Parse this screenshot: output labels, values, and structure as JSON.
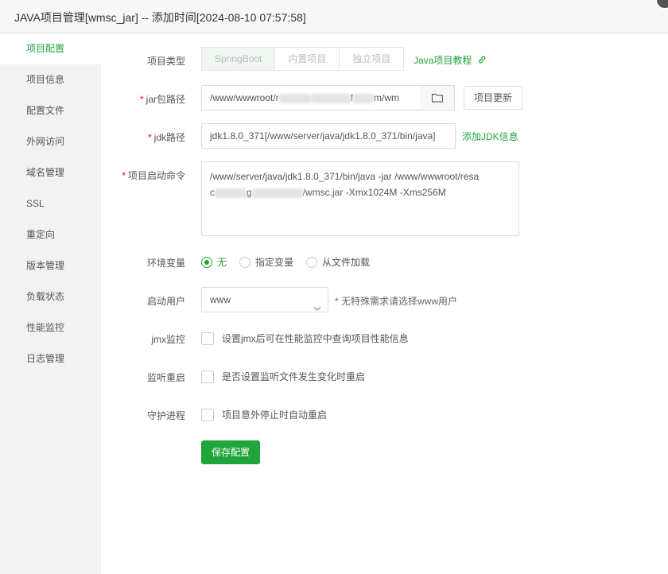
{
  "window": {
    "title": "JAVA项目管理[wmsc_jar] -- 添加时间[2024-08-10 07:57:58]"
  },
  "sidebar": {
    "items": [
      {
        "label": "项目配置",
        "active": true
      },
      {
        "label": "项目信息"
      },
      {
        "label": "配置文件"
      },
      {
        "label": "外网访问"
      },
      {
        "label": "域名管理"
      },
      {
        "label": "SSL"
      },
      {
        "label": "重定向"
      },
      {
        "label": "版本管理"
      },
      {
        "label": "负载状态"
      },
      {
        "label": "性能监控"
      },
      {
        "label": "日志管理"
      }
    ]
  },
  "form": {
    "project_type": {
      "label": "项目类型",
      "options": [
        "SpringBoot",
        "内置项目",
        "独立项目"
      ],
      "selected": "SpringBoot",
      "tutorial_link": "Java项目教程"
    },
    "jar_path": {
      "label": "jar包路径",
      "value_prefix": "/www/wwwroot/r",
      "value_mid1": "",
      "value_mid2": "f",
      "value_suffix": "m/wm",
      "update_button": "项目更新"
    },
    "jdk_path": {
      "label": "jdk路径",
      "value": "jdk1.8.0_371[/www/server/java/jdk1.8.0_371/bin/java]",
      "add_link": "添加JDK信息"
    },
    "start_command": {
      "label": "项目启动命令",
      "line1": "/www/server/java/jdk1.8.0_371/bin/java -jar /www/wwwroot/resa",
      "line2_prefix": "c",
      "line2_mid": "g",
      "line2_suffix": "/wmsc.jar -Xmx1024M -Xms256M"
    },
    "env_vars": {
      "label": "环境变量",
      "options": [
        "无",
        "指定变量",
        "从文件加载"
      ],
      "selected": "无"
    },
    "start_user": {
      "label": "启动用户",
      "value": "www",
      "hint": "* 无特殊需求请选择www用户"
    },
    "jmx": {
      "label": "jmx监控",
      "checkbox_label": "设置jmx后可在性能监控中查询项目性能信息"
    },
    "watch_restart": {
      "label": "监听重启",
      "checkbox_label": "是否设置监听文件发生变化时重启"
    },
    "daemon": {
      "label": "守护进程",
      "checkbox_label": "项目意外停止时自动重启"
    },
    "save_button": "保存配置"
  },
  "colors": {
    "accent": "#20a53a",
    "required": "#ef0808",
    "sidebar_bg": "#f2f2f2",
    "titlebar_bg": "#f7f7f7"
  },
  "icons": {
    "tutorial": "external-link-icon",
    "folder": "folder-icon",
    "select": "chevron-down-icon",
    "close": "close-icon"
  }
}
